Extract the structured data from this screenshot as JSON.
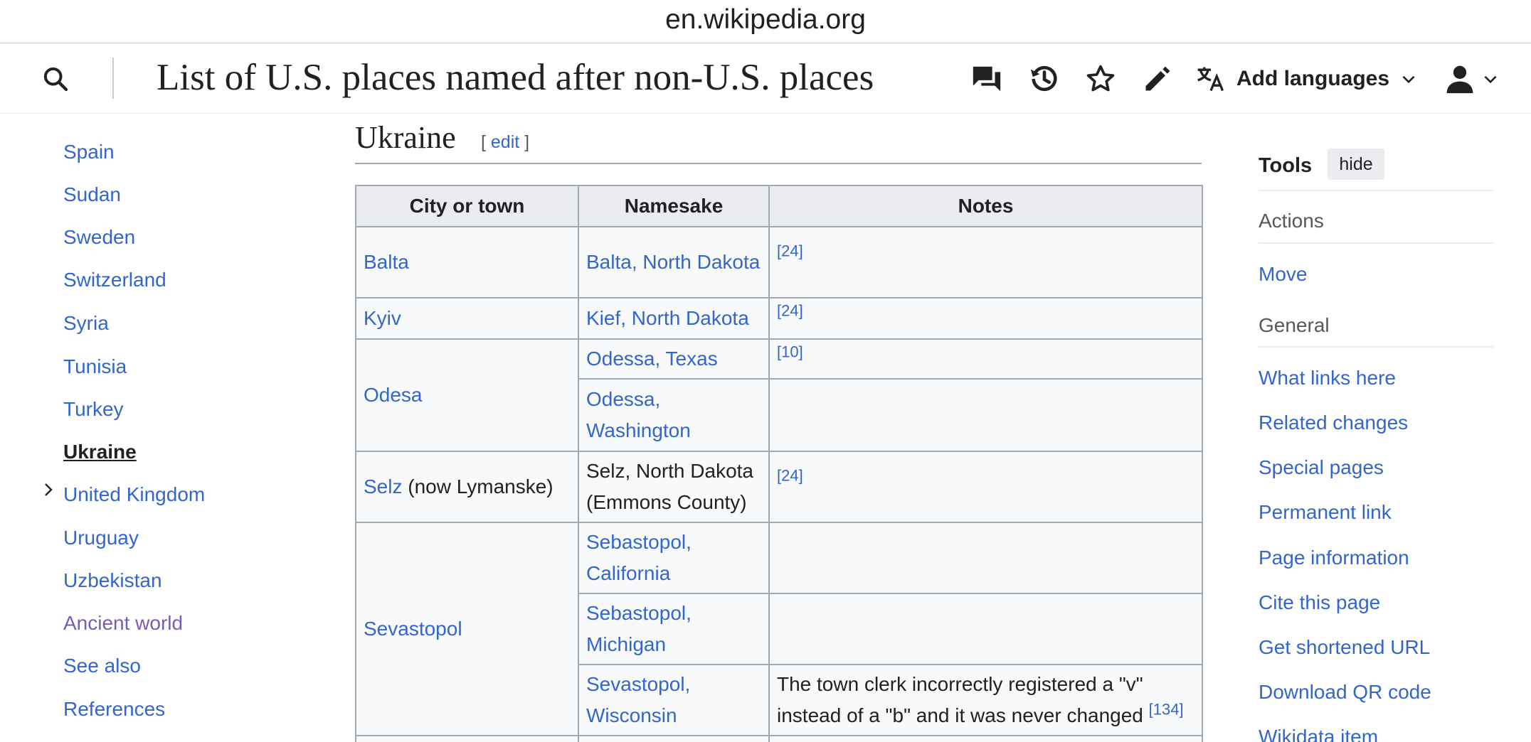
{
  "browser": {
    "url": "en.wikipedia.org"
  },
  "header": {
    "title": "List of U.S. places named after non-U.S. places",
    "add_languages": "Add languages",
    "icons": [
      "search-icon",
      "talk-icon",
      "history-icon",
      "star-icon",
      "pencil-icon",
      "translate-icon",
      "user-icon"
    ]
  },
  "toc": {
    "items": [
      {
        "label": "Spain"
      },
      {
        "label": "Sudan"
      },
      {
        "label": "Sweden"
      },
      {
        "label": "Switzerland"
      },
      {
        "label": "Syria"
      },
      {
        "label": "Tunisia"
      },
      {
        "label": "Turkey"
      },
      {
        "label": "Ukraine"
      },
      {
        "label": "United Kingdom"
      },
      {
        "label": "Uruguay"
      },
      {
        "label": "Uzbekistan"
      },
      {
        "label": "Ancient world"
      },
      {
        "label": "See also"
      },
      {
        "label": "References"
      }
    ]
  },
  "section": {
    "title": "Ukraine",
    "edit_open": "[ ",
    "edit_label": "edit",
    "edit_close": " ]"
  },
  "table": {
    "headers": [
      "City or town",
      "Namesake",
      "Notes"
    ],
    "rows": [
      {
        "city": "Balta",
        "namesake": "Balta, North Dakota",
        "note": "[24]"
      },
      {
        "city": "Kyiv",
        "namesake": "Kief, North Dakota",
        "note": "[24]"
      },
      {
        "city": "Odesa",
        "namesake": "Odessa, Texas",
        "note": "[10]"
      },
      {
        "namesake": "Odessa, Washington",
        "note": ""
      },
      {
        "city": "Selz",
        "city_suffix": " (now Lymanske)",
        "namesake": "Selz, North Dakota (Emmons County)",
        "note": "[24]"
      },
      {
        "city": "Sevastopol",
        "namesake": "Sebastopol, California",
        "note": ""
      },
      {
        "namesake": "Sebastopol, Michigan",
        "note": ""
      },
      {
        "namesake": "Sevastopol, Wisconsin",
        "note_text": "The town clerk incorrectly registered a \"v\" instead of a \"b\" and it was never changed ",
        "note": "[134]"
      }
    ]
  },
  "tools": {
    "title": "Tools",
    "hide_label": "hide",
    "actions_heading": "Actions",
    "move_label": "Move",
    "general_heading": "General",
    "links": [
      "What links here",
      "Related changes",
      "Special pages",
      "Permanent link",
      "Page information",
      "Cite this page",
      "Get shortened URL",
      "Download QR code",
      "Wikidata item"
    ]
  },
  "colors": {
    "link": "#3366cc",
    "visited": "#795cb2",
    "text": "#202122",
    "border": "#a2a9b1",
    "header_bg": "#eaecf0"
  }
}
